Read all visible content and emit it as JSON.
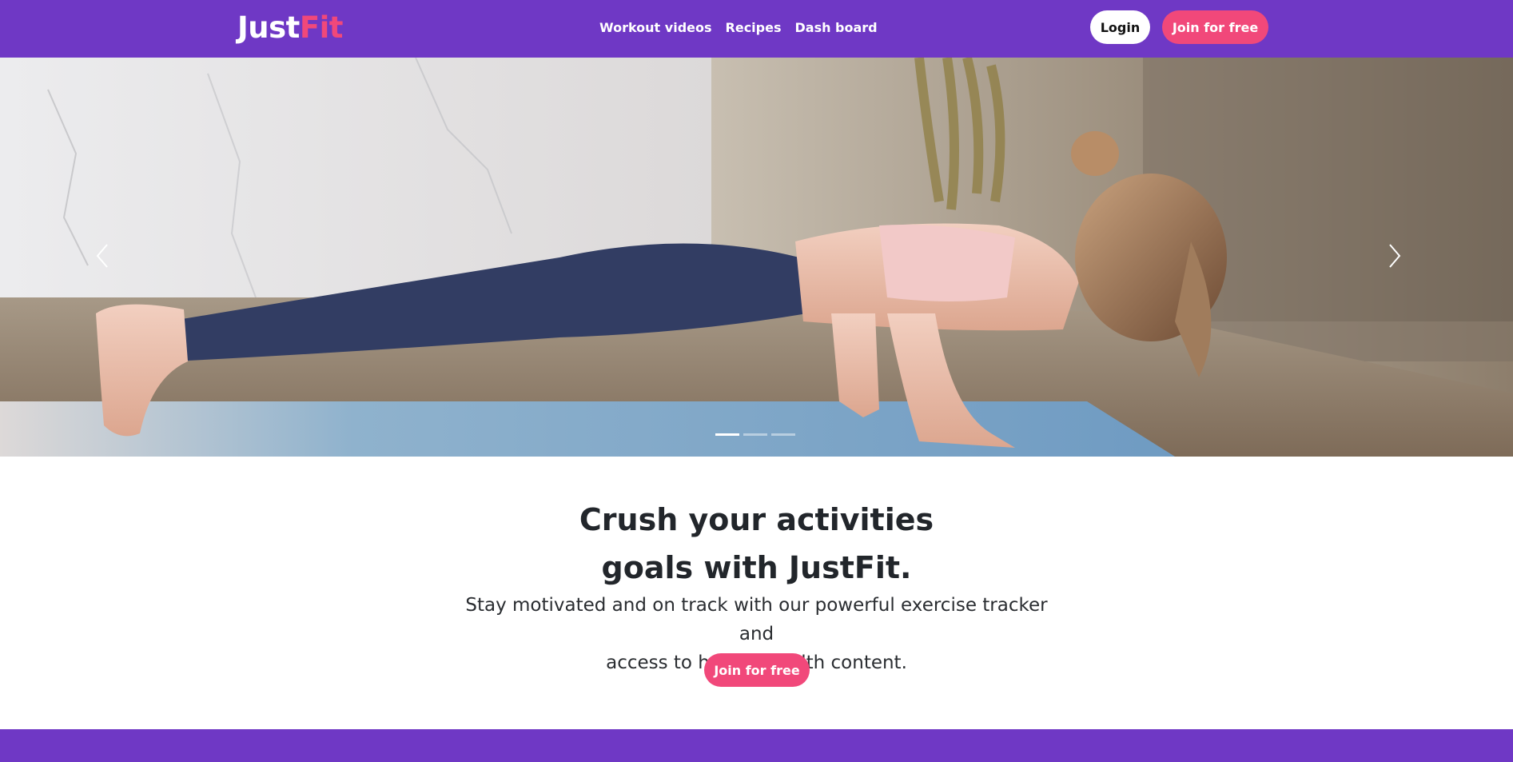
{
  "header": {
    "logo_part1": "Just",
    "logo_part2": "Fit",
    "nav": [
      "Workout videos",
      "Recipes",
      "Dash board"
    ],
    "login_label": "Login",
    "join_label": "Join for free"
  },
  "carousel": {
    "slide_count": 3,
    "active_slide": 1
  },
  "hero": {
    "headline_line1": "Crush your activities",
    "headline_line2": "goals with JustFit.",
    "subtext_line1": "Stay motivated and on track with our powerful exercise tracker and",
    "subtext_line2": "access to helpful health content.",
    "cta_label": "Join for free"
  },
  "colors": {
    "brand_purple": "#6f38c5",
    "accent_pink": "#f1487a"
  },
  "icons": {
    "prev": "chevron-left-icon",
    "next": "chevron-right-icon"
  }
}
